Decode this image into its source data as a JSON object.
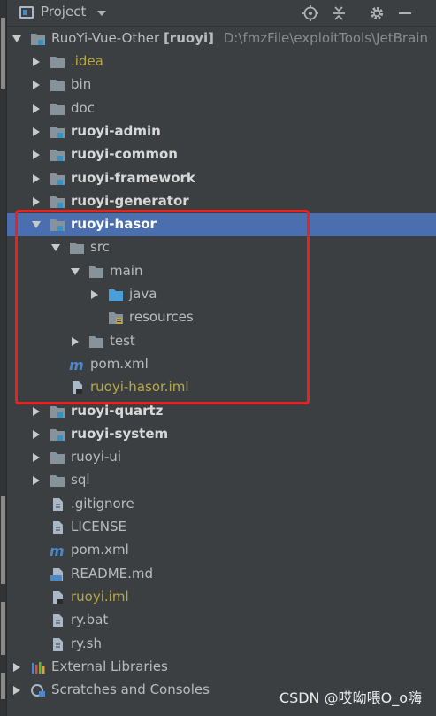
{
  "header": {
    "title": "Project",
    "icons": [
      "locate-icon",
      "collapse-all-icon",
      "settings-icon",
      "minimize-icon"
    ]
  },
  "tree": {
    "root": {
      "label": "RuoYi-Vue-Other",
      "module": "[ruoyi]",
      "path": "D:\\fmzFile\\exploitTools\\JetBrain"
    },
    "items": [
      {
        "label": ".idea"
      },
      {
        "label": "bin"
      },
      {
        "label": "doc"
      },
      {
        "label": "ruoyi-admin"
      },
      {
        "label": "ruoyi-common"
      },
      {
        "label": "ruoyi-framework"
      },
      {
        "label": "ruoyi-generator"
      },
      {
        "label": "ruoyi-hasor"
      },
      {
        "label": "src"
      },
      {
        "label": "main"
      },
      {
        "label": "java"
      },
      {
        "label": "resources"
      },
      {
        "label": "test"
      },
      {
        "label": "pom.xml"
      },
      {
        "label": "ruoyi-hasor.iml"
      },
      {
        "label": "ruoyi-quartz"
      },
      {
        "label": "ruoyi-system"
      },
      {
        "label": "ruoyi-ui"
      },
      {
        "label": "sql"
      },
      {
        "label": ".gitignore"
      },
      {
        "label": "LICENSE"
      },
      {
        "label": "pom.xml"
      },
      {
        "label": "README.md"
      },
      {
        "label": "ruoyi.iml"
      },
      {
        "label": "ry.bat"
      },
      {
        "label": "ry.sh"
      },
      {
        "label": "External Libraries"
      },
      {
        "label": "Scratches and Consoles"
      }
    ]
  },
  "watermark": "CSDN @哎呦喂O_o嗨",
  "colors": {
    "background": "#3c3f41",
    "selection": "#4b6eaf",
    "highlight_box": "#e8231f",
    "folder": "#87939a",
    "source_folder": "#4a9fd8",
    "excluded_text": "#b8a948"
  }
}
